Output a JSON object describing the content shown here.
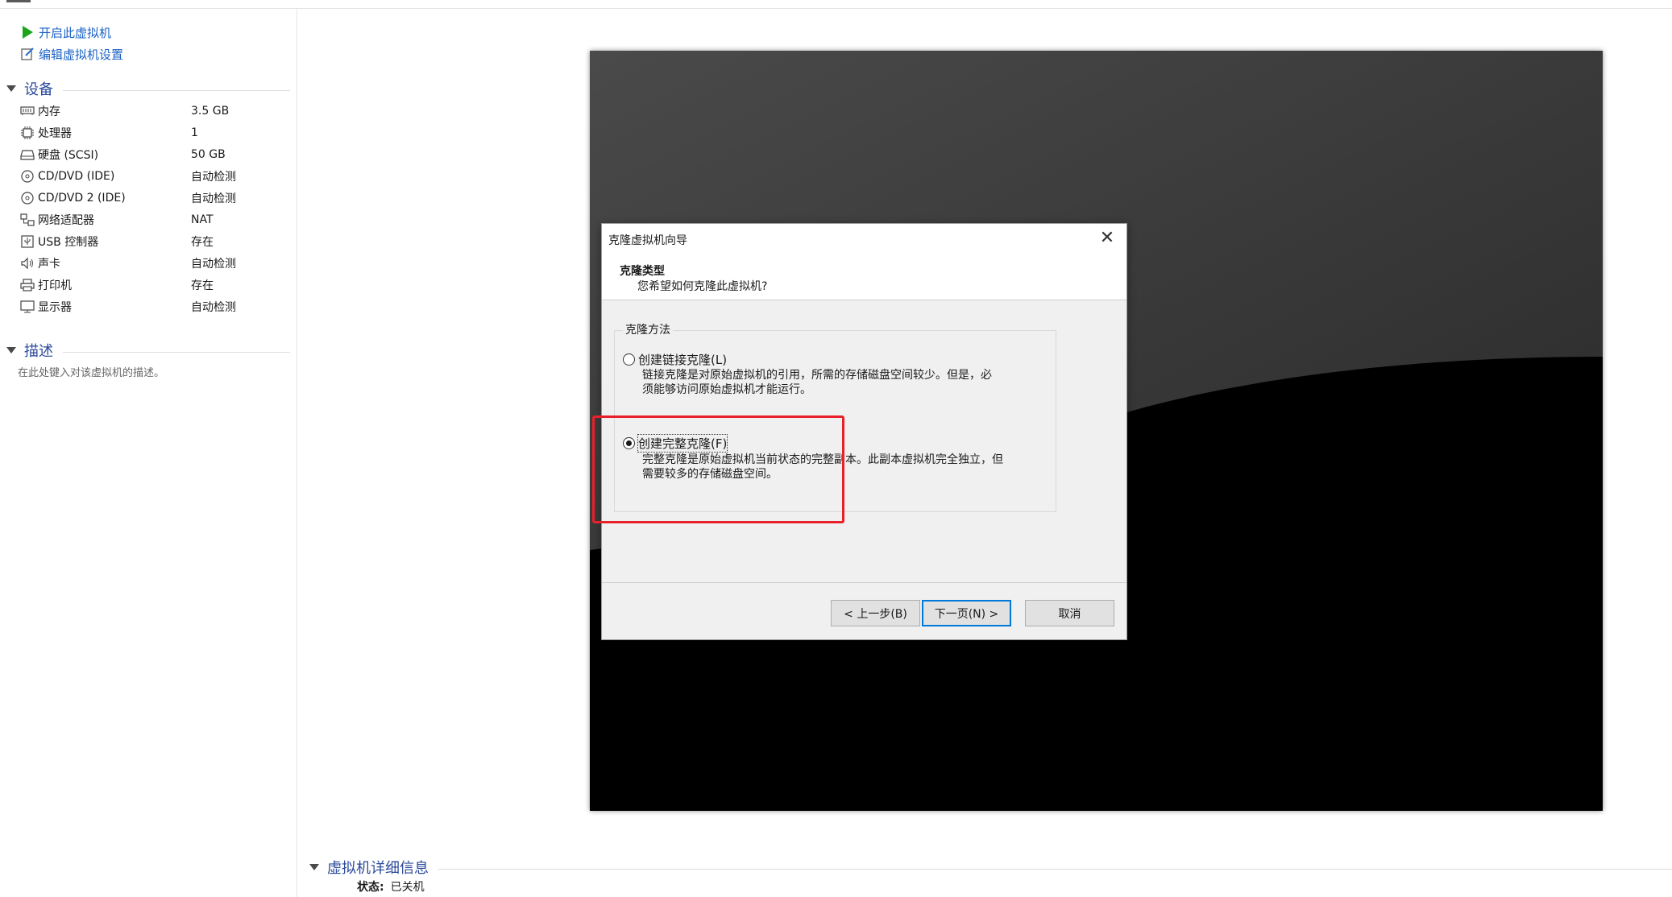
{
  "left_panel": {
    "actions": [
      {
        "label": "开启此虚拟机",
        "icon": "play-icon"
      },
      {
        "label": "编辑虚拟机设置",
        "icon": "edit-settings-icon"
      }
    ],
    "devices_section": {
      "title": "设备",
      "items": [
        {
          "name": "内存",
          "value": "3.5 GB",
          "icon": "memory-icon"
        },
        {
          "name": "处理器",
          "value": "1",
          "icon": "cpu-icon"
        },
        {
          "name": "硬盘 (SCSI)",
          "value": "50 GB",
          "icon": "harddisk-icon"
        },
        {
          "name": "CD/DVD (IDE)",
          "value": "自动检测",
          "icon": "cd-icon"
        },
        {
          "name": "CD/DVD 2 (IDE)",
          "value": "自动检测",
          "icon": "cd-icon"
        },
        {
          "name": "网络适配器",
          "value": "NAT",
          "icon": "network-icon"
        },
        {
          "name": "USB 控制器",
          "value": "存在",
          "icon": "usb-icon"
        },
        {
          "name": "声卡",
          "value": "自动检测",
          "icon": "sound-icon"
        },
        {
          "name": "打印机",
          "value": "存在",
          "icon": "printer-icon"
        },
        {
          "name": "显示器",
          "value": "自动检测",
          "icon": "monitor-icon"
        }
      ]
    },
    "description_section": {
      "title": "描述",
      "placeholder": "在此处键入对该虚拟机的描述。"
    }
  },
  "dialog": {
    "window_title": "克隆虚拟机向导",
    "heading": "克隆类型",
    "subheading": "您希望如何克隆此虚拟机?",
    "group_label": "克隆方法",
    "options": [
      {
        "label": "创建链接克隆(L)",
        "selected": false,
        "desc_line1": "链接克隆是对原始虚拟机的引用，所需的存储磁盘空间较少。但是，必",
        "desc_line2": "须能够访问原始虚拟机才能运行。"
      },
      {
        "label": "创建完整克隆(F)",
        "selected": true,
        "desc_line1": "完整克隆是原始虚拟机当前状态的完整副本。此副本虚拟机完全独立，但",
        "desc_line2": "需要较多的存储磁盘空间。"
      }
    ],
    "buttons": {
      "back": "< 上一步(B)",
      "next": "下一页(N) >",
      "cancel": "取消"
    }
  },
  "details": {
    "title": "虚拟机详细信息",
    "status_key": "状态:",
    "status_value": "已关机"
  },
  "colors": {
    "link_blue": "#1a62c4",
    "section_blue": "#2b4a9b",
    "highlight_red": "#e8202a",
    "play_green": "#1aa51a"
  }
}
